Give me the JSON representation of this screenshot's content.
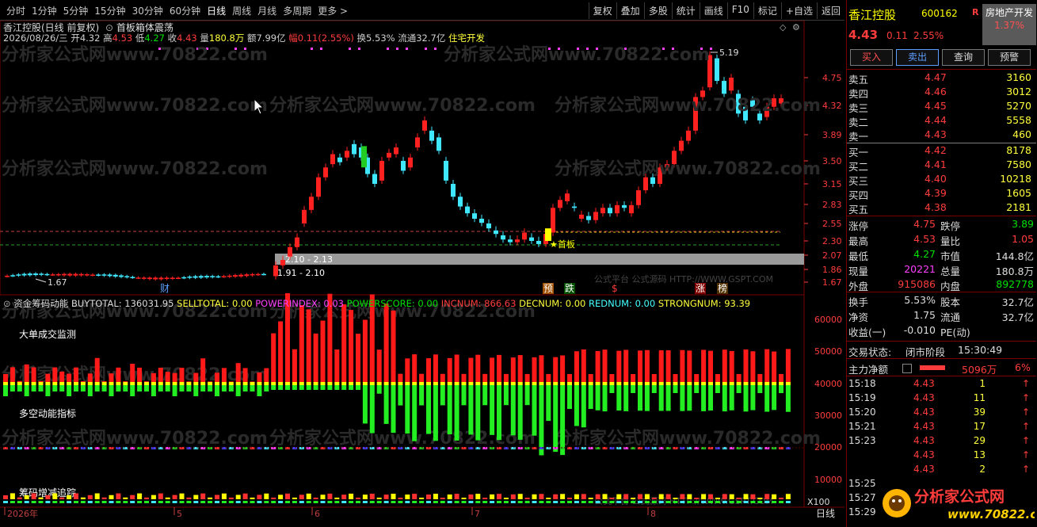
{
  "toolbar": {
    "tabs": [
      "分时",
      "1分钟",
      "5分钟",
      "15分钟",
      "30分钟",
      "60分钟",
      "日线",
      "周线",
      "月线",
      "多周期",
      "更多 >"
    ],
    "active_tab": "日线",
    "right_tools": [
      "复权",
      "叠加",
      "多股",
      "统计",
      "画线",
      "F10",
      "标记",
      "+自选",
      "返回"
    ]
  },
  "header": {
    "stock_title": "香江控股(日线 前复权)",
    "pattern": "首板箱体震荡",
    "date": "2026/08/26/三",
    "open_label": "开",
    "open": "4.32",
    "high_label": "高",
    "high": "4.53",
    "low_label": "低",
    "low": "4.27",
    "close_label": "收",
    "close": "4.43",
    "vol_label": "量",
    "vol": "180.8万",
    "amt_label": "额",
    "amt": "7.99亿",
    "amp_label": "幅",
    "amp": "0.11(2.55%)",
    "turn_label": "换",
    "turn": "5.53%",
    "float_label": "流通",
    "float": "32.7亿",
    "sector": "住宅开发"
  },
  "main_chart": {
    "price_axis": [
      "4.75",
      "4.32",
      "3.89",
      "3.50",
      "3.15",
      "2.83",
      "2.55",
      "2.30",
      "2.07",
      "1.86",
      "1.67"
    ],
    "peak_label": "5.19",
    "low_label": "1.67",
    "box_label_1": "2.10 - 2.13",
    "box_label_2": "1.91 - 2.10",
    "first_board": "★首板",
    "markers": [
      "财",
      "预",
      "跌",
      "$",
      "涨",
      "榜"
    ],
    "watermark": "分析家公式网www.70822.com",
    "platform_text": "公式平台 公式源码 HTTP://WWW.GSPT.COM"
  },
  "indicator": {
    "name": "资金筹码动能",
    "buytotal": "BUYTOTAL: 136031.95",
    "selltotal": "SELLTOTAL: 0.00",
    "powerindex": "POWERINDEX: 0.03",
    "powerscore": "POWERSCORE: 0.00",
    "incnum": "INCNUM: 866.63",
    "decnum": "DECNUM: 0.00",
    "rednum": "REDNUM: 0.00",
    "strongnum": "STRONGNUM: 93.39",
    "label1": "大单成交监测",
    "label2": "多空动能指标",
    "label3": "筹码增减追踪",
    "axis": [
      "60000",
      "50000",
      "40000",
      "30000",
      "20000",
      "10000"
    ],
    "x100": "X100"
  },
  "time_axis": {
    "labels": [
      "2026年",
      "5",
      "6",
      "7",
      "8"
    ],
    "period": "日线"
  },
  "sidebar": {
    "name": "香江控股",
    "code": "600162",
    "r": "R",
    "sector_name": "房地产开发",
    "sector_pct": "1.37%",
    "price": "4.43",
    "change": "0.11",
    "change_pct": "2.55%",
    "buttons": [
      "买入",
      "卖出",
      "查询",
      "预警"
    ],
    "asks": [
      {
        "label": "卖五",
        "price": "4.47",
        "vol": "3160"
      },
      {
        "label": "卖四",
        "price": "4.46",
        "vol": "3012"
      },
      {
        "label": "卖三",
        "price": "4.45",
        "vol": "5270"
      },
      {
        "label": "卖二",
        "price": "4.44",
        "vol": "5558"
      },
      {
        "label": "卖一",
        "price": "4.43",
        "vol": "460"
      }
    ],
    "bids": [
      {
        "label": "买一",
        "price": "4.42",
        "vol": "8178"
      },
      {
        "label": "买二",
        "price": "4.41",
        "vol": "7580"
      },
      {
        "label": "买三",
        "price": "4.40",
        "vol": "10218"
      },
      {
        "label": "买四",
        "price": "4.39",
        "vol": "1605"
      },
      {
        "label": "买五",
        "price": "4.38",
        "vol": "2181"
      }
    ],
    "stats": [
      {
        "l1": "涨停",
        "v1": "4.75",
        "l2": "跌停",
        "v2": "3.89"
      },
      {
        "l1": "最高",
        "v1": "4.53",
        "l2": "量比",
        "v2": "1.05"
      },
      {
        "l1": "最低",
        "v1": "4.27",
        "l2": "市值",
        "v2": "144.8亿"
      },
      {
        "l1": "现量",
        "v1": "20221",
        "l2": "总量",
        "v2": "180.8万"
      },
      {
        "l1": "外盘",
        "v1": "915086",
        "l2": "内盘",
        "v2": "892778"
      }
    ],
    "stats2": [
      {
        "l1": "换手",
        "v1": "5.53%",
        "l2": "股本",
        "v2": "32.7亿"
      },
      {
        "l1": "净资",
        "v1": "1.75",
        "l2": "流通",
        "v2": "32.7亿"
      },
      {
        "l1": "收益(一)",
        "v1": "-0.010",
        "l2": "PE(动)",
        "v2": ""
      }
    ],
    "trade_status_label": "交易状态:",
    "trade_status": "闭市阶段",
    "trade_time": "15:30:49",
    "net_label": "主力净额",
    "net_value": "5096万",
    "net_pct": "6%",
    "ticks": [
      {
        "t": "15:18",
        "p": "4.43",
        "v": "1"
      },
      {
        "t": "15:19",
        "p": "4.43",
        "v": "11"
      },
      {
        "t": "15:20",
        "p": "4.43",
        "v": "39"
      },
      {
        "t": "15:21",
        "p": "4.43",
        "v": "17"
      },
      {
        "t": "15:23",
        "p": "4.43",
        "v": "29"
      },
      {
        "t": "",
        "p": "4.43",
        "v": "13"
      },
      {
        "t": "",
        "p": "4.43",
        "v": "2"
      },
      {
        "t": "15:25",
        "p": "",
        "v": ""
      },
      {
        "t": "15:27",
        "p": "",
        "v": ""
      },
      {
        "t": "15:29",
        "p": "",
        "v": ""
      }
    ],
    "logo_text": "分析家公式网",
    "logo_url": "www.70822.com"
  }
}
